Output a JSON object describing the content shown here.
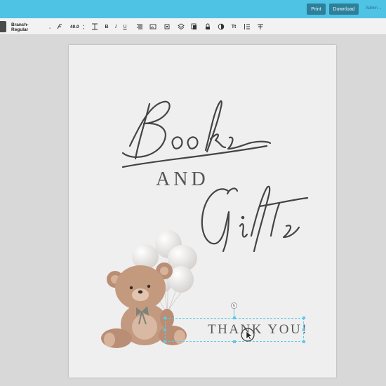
{
  "topbar": {
    "print_label": "Print",
    "download_label": "Download",
    "admin_label": "Admin",
    "bg_color": "#4fc3e3"
  },
  "toolbar": {
    "font_family": "Branch-Regular",
    "font_size": "40.0"
  },
  "canvas": {
    "line1": "Books",
    "line2": "AND",
    "line3": "Gifts",
    "thank_you": "THANK YOU!"
  }
}
